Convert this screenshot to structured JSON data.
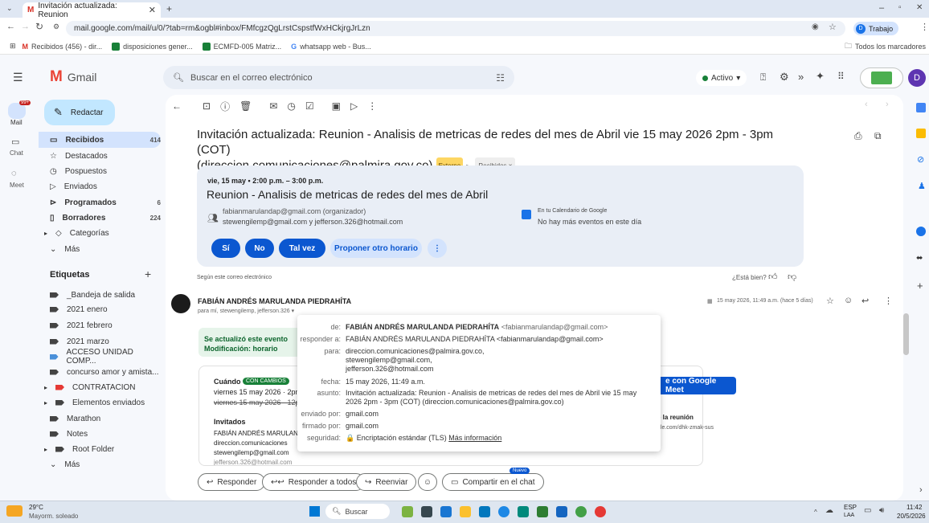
{
  "browser": {
    "tab_title": "Invitación actualizada: Reunion",
    "url": "mail.google.com/mail/u/0/?tab=rm&ogbl#inbox/FMfcgzQgLrstCspstfWxHCkjrgJrLzn",
    "profile": "Trabajo",
    "bookmarks": [
      "Recibidos (456) - dir...",
      "disposiciones gener...",
      "ECMFD-005 Matriz...",
      "whatsapp web - Bus..."
    ],
    "all_bookmarks": "Todos los marcadores"
  },
  "gmail": {
    "logo": "Gmail",
    "search_placeholder": "Buscar en el correo electrónico",
    "status": "Activo",
    "avatar_letter": "D",
    "rail": {
      "mail": "Mail",
      "chat": "Chat",
      "meet": "Meet",
      "badge": "99+"
    },
    "compose": "Redactar",
    "nav": [
      {
        "label": "Recibidos",
        "count": "414"
      },
      {
        "label": "Destacados",
        "count": ""
      },
      {
        "label": "Pospuestos",
        "count": ""
      },
      {
        "label": "Enviados",
        "count": ""
      },
      {
        "label": "Programados",
        "count": "6"
      },
      {
        "label": "Borradores",
        "count": "224"
      },
      {
        "label": "Categorías",
        "count": ""
      },
      {
        "label": "Más",
        "count": ""
      }
    ],
    "labels_title": "Etiquetas",
    "labels": [
      "_Bandeja de salida",
      "2021 enero",
      "2021 febrero",
      "2021 marzo",
      "ACCESO UNIDAD COMP...",
      "concurso amor y amista...",
      "CONTRATACION",
      "Elementos enviados",
      "Marathon",
      "Notes",
      "Root Folder",
      "Más"
    ]
  },
  "email": {
    "subject": "Invitación actualizada: Reunion - Analisis de metricas de redes del mes de Abril vie 15 may 2026 2pm - 3pm (COT)",
    "subject_line2": "(direccion.comunicaciones@palmira.gov.co)",
    "external_badge": "Externo",
    "inbox_chip": "Recibidos ×",
    "invite": {
      "datetime": "vie, 15 may • 2:00 p.m. – 3:00 p.m.",
      "title": "Reunion - Analisis de metricas de redes del mes de Abril",
      "organizer": "fabianmarulandap@gmail.com (organizador)",
      "guests": "stewengilemp@gmail.com y jefferson.326@hotmail.com",
      "calendar_title": "En tu Calendario de Google",
      "calendar_note": "No hay más eventos en este día",
      "rsvp": [
        "Sí",
        "No",
        "Tal vez"
      ],
      "propose": "Proponer otro horario"
    },
    "according": "Según este correo electrónico",
    "feedback": "¿Está bien?",
    "sender_name": "FABIÁN ANDRÉS MARULANDA PIEDRAHÍTA",
    "sender_to": "para mí, stewengilemp, jefferson.326 ▾",
    "date": "15 may 2026, 11:49 a.m. (hace 5 días)",
    "green_title": "Se actualizó este evento",
    "green_sub": "Modificación: horario",
    "when_label": "Cuándo",
    "when_badge": "CON CAMBIOS",
    "when_new": "viernes 15 may 2026 · 2pm",
    "when_old": "viernes 15 may 2026 · 12p",
    "meet_button": "e con Google Meet",
    "invitados_label": "Invitados",
    "invitados": [
      "FABIÁN ANDRÉS MARULAN",
      "direccion.comunicaciones",
      "stewengilemp@gmail.com",
      "jefferson.326@hotmail.com"
    ],
    "join_label": "e la reunión",
    "join_link": "gle.com/dhk-zmak-sus",
    "popup": {
      "de_key": "de:",
      "de_val": "FABIÁN ANDRÉS MARULANDA PIEDRAHÍTA",
      "de_mail": "<fabianmarulandap@gmail.com>",
      "reply_key": "responder a:",
      "reply_val": "FABIÁN ANDRÉS MARULANDA PIEDRAHÍTA <fabianmarulandap@gmail.com>",
      "para_key": "para:",
      "para_val": [
        "direccion.comunicaciones@palmira.gov.co,",
        "stewengilemp@gmail.com,",
        "jefferson.326@hotmail.com"
      ],
      "fecha_key": "fecha:",
      "fecha_val": "15 may 2026, 11:49 a.m.",
      "asunto_key": "asunto:",
      "asunto_val": "Invitación actualizada: Reunion - Analisis de metricas de redes del mes de Abril vie 15 may 2026 2pm - 3pm (COT) (direccion.comunicaciones@palmira.gov.co)",
      "enviado_key": "enviado por:",
      "enviado_val": "gmail.com",
      "firmado_key": "firmado por:",
      "firmado_val": "gmail.com",
      "seguridad_key": "seguridad:",
      "seguridad_val": "🔒 Encriptación estándar (TLS)",
      "mas_info": "Más información"
    },
    "actions": {
      "reply": "Responder",
      "reply_all": "Responder a todos",
      "forward": "Reenviar",
      "share": "Compartir en el chat",
      "new_badge": "Nuevo"
    }
  },
  "taskbar": {
    "weather_temp": "29°C",
    "weather_desc": "Mayorm. soleado",
    "search": "Buscar",
    "lang": "ESP",
    "lang2": "LAA",
    "time": "11:42",
    "date": "20/5/2026"
  }
}
